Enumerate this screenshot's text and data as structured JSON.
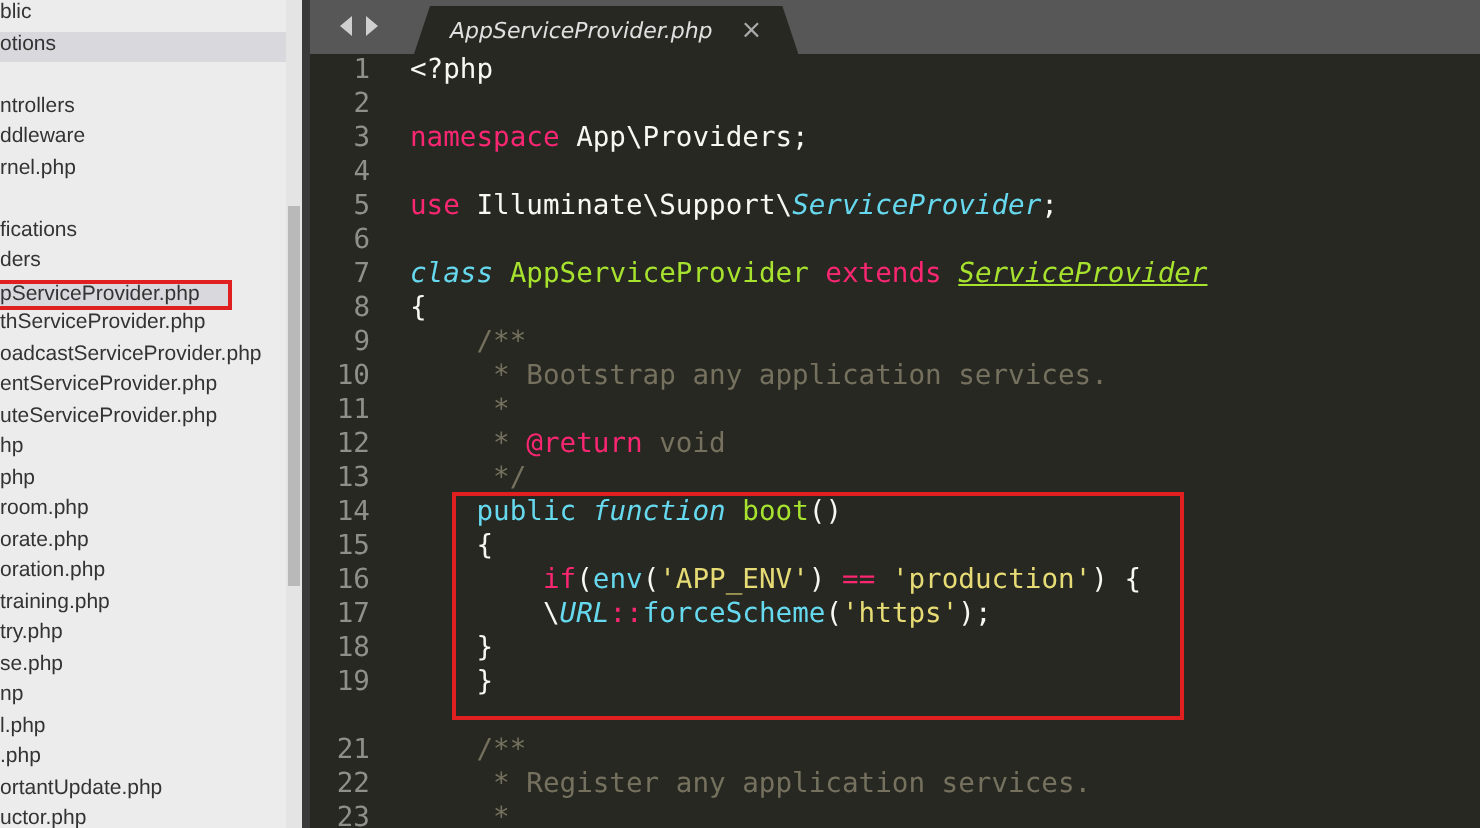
{
  "sidebar": {
    "groups": [
      {
        "items": [
          {
            "label": "blic",
            "selected": false,
            "annotated": false
          },
          {
            "label": "otions",
            "selected": true,
            "annotated": false
          }
        ]
      },
      {
        "items": [
          {
            "label": "ntrollers",
            "selected": false,
            "annotated": false
          },
          {
            "label": "ddleware",
            "selected": false,
            "annotated": false
          },
          {
            "label": "rnel.php",
            "selected": false,
            "annotated": false
          }
        ]
      },
      {
        "items": [
          {
            "label": "fications",
            "selected": false,
            "annotated": false
          },
          {
            "label": "ders",
            "selected": false,
            "annotated": false
          },
          {
            "label": "pServiceProvider.php",
            "selected": true,
            "annotated": true
          },
          {
            "label": "thServiceProvider.php",
            "selected": false,
            "annotated": false
          },
          {
            "label": "oadcastServiceProvider.php",
            "selected": false,
            "annotated": false
          },
          {
            "label": "entServiceProvider.php",
            "selected": false,
            "annotated": false
          },
          {
            "label": "uteServiceProvider.php",
            "selected": false,
            "annotated": false
          },
          {
            "label": "hp",
            "selected": false,
            "annotated": false
          },
          {
            "label": "php",
            "selected": false,
            "annotated": false
          },
          {
            "label": "room.php",
            "selected": false,
            "annotated": false
          },
          {
            "label": "orate.php",
            "selected": false,
            "annotated": false
          },
          {
            "label": "oration.php",
            "selected": false,
            "annotated": false
          },
          {
            "label": "training.php",
            "selected": false,
            "annotated": false
          },
          {
            "label": "try.php",
            "selected": false,
            "annotated": false
          },
          {
            "label": "se.php",
            "selected": false,
            "annotated": false
          },
          {
            "label": "np",
            "selected": false,
            "annotated": false
          },
          {
            "label": "l.php",
            "selected": false,
            "annotated": false
          },
          {
            "label": ".php",
            "selected": false,
            "annotated": false
          },
          {
            "label": "ortantUpdate.php",
            "selected": false,
            "annotated": false
          },
          {
            "label": "uctor.php",
            "selected": false,
            "annotated": false
          }
        ]
      }
    ]
  },
  "tabs": [
    {
      "label": "AppServiceProvider.php",
      "selected": true,
      "close": "×"
    }
  ],
  "editor": {
    "lines": [
      {
        "number": "1",
        "tokens": [
          {
            "text": "<?php",
            "kind": "plain"
          }
        ]
      },
      {
        "number": "2"
      },
      {
        "number": "3",
        "tokens": [
          {
            "text": "namespace",
            "kind": "keyword"
          },
          {
            "text": " App\\Providers;",
            "kind": "plain"
          }
        ]
      },
      {
        "number": "4"
      },
      {
        "number": "5",
        "tokens": [
          {
            "text": "use",
            "kind": "keyword"
          },
          {
            "text": " Illuminate\\Support\\",
            "kind": "plain"
          },
          {
            "text": "ServiceProvider",
            "kind": "type"
          },
          {
            "text": ";",
            "kind": "plain"
          }
        ]
      },
      {
        "number": "6"
      },
      {
        "number": "7",
        "tokens": [
          {
            "text": "class",
            "kind": "storage"
          },
          {
            "text": " AppServiceProvider",
            "kind": "entity"
          },
          {
            "text": " extends ",
            "kind": "keyword"
          },
          {
            "text": "ServiceProvider",
            "kind": "inherited"
          }
        ]
      },
      {
        "number": "8",
        "tokens": [
          {
            "text": "{",
            "kind": "plain"
          }
        ]
      },
      {
        "number": "9",
        "tokens": [
          {
            "text": "    /**",
            "kind": "comment"
          }
        ]
      },
      {
        "number": "10",
        "tokens": [
          {
            "text": "     * Bootstrap any application services.",
            "kind": "comment"
          }
        ]
      },
      {
        "number": "11",
        "tokens": [
          {
            "text": "     *",
            "kind": "comment"
          }
        ]
      },
      {
        "number": "12",
        "tokens": [
          {
            "text": "     * ",
            "kind": "comment"
          },
          {
            "text": "@return",
            "kind": "keyword"
          },
          {
            "text": " void",
            "kind": "comment"
          }
        ]
      },
      {
        "number": "13",
        "tokens": [
          {
            "text": "     */",
            "kind": "comment"
          }
        ]
      }
    ],
    "highlight": {
      "lines": [
        {
          "number": "14",
          "tokens": [
            {
              "text": "    public",
              "kind": "modifier"
            },
            {
              "text": " function",
              "kind": "storage"
            },
            {
              "text": " boot",
              "kind": "entity"
            },
            {
              "text": "()",
              "kind": "plain"
            }
          ]
        },
        {
          "number": "15",
          "tokens": [
            {
              "text": "    {",
              "kind": "plain"
            }
          ]
        },
        {
          "number": "16",
          "tokens": [
            {
              "text": "        if",
              "kind": "keyword"
            },
            {
              "text": "(",
              "kind": "plain"
            },
            {
              "text": "env",
              "kind": "support"
            },
            {
              "text": "(",
              "kind": "plain"
            },
            {
              "text": "'APP_ENV'",
              "kind": "string"
            },
            {
              "text": ") ",
              "kind": "plain"
            },
            {
              "text": "==",
              "kind": "keyword"
            },
            {
              "text": " 'production'",
              "kind": "string"
            },
            {
              "text": ") {",
              "kind": "plain"
            }
          ]
        },
        {
          "number": "17",
          "tokens": [
            {
              "text": "        \\",
              "kind": "plain"
            },
            {
              "text": "URL",
              "kind": "type"
            },
            {
              "text": "::",
              "kind": "keyword"
            },
            {
              "text": "forceScheme",
              "kind": "support"
            },
            {
              "text": "(",
              "kind": "plain"
            },
            {
              "text": "'https'",
              "kind": "string"
            },
            {
              "text": ");",
              "kind": "plain"
            }
          ]
        },
        {
          "number": "18",
          "tokens": [
            {
              "text": "    }",
              "kind": "plain"
            }
          ]
        },
        {
          "number": "19",
          "tokens": [
            {
              "text": "    }",
              "kind": "plain"
            }
          ]
        }
      ]
    },
    "lines_after": [
      {
        "number": "21",
        "tokens": [
          {
            "text": "    /**",
            "kind": "comment"
          }
        ]
      },
      {
        "number": "22",
        "tokens": [
          {
            "text": "     * Register any application services.",
            "kind": "comment"
          }
        ]
      },
      {
        "number": "23",
        "tokens": [
          {
            "text": "     *",
            "kind": "comment"
          }
        ]
      }
    ]
  }
}
